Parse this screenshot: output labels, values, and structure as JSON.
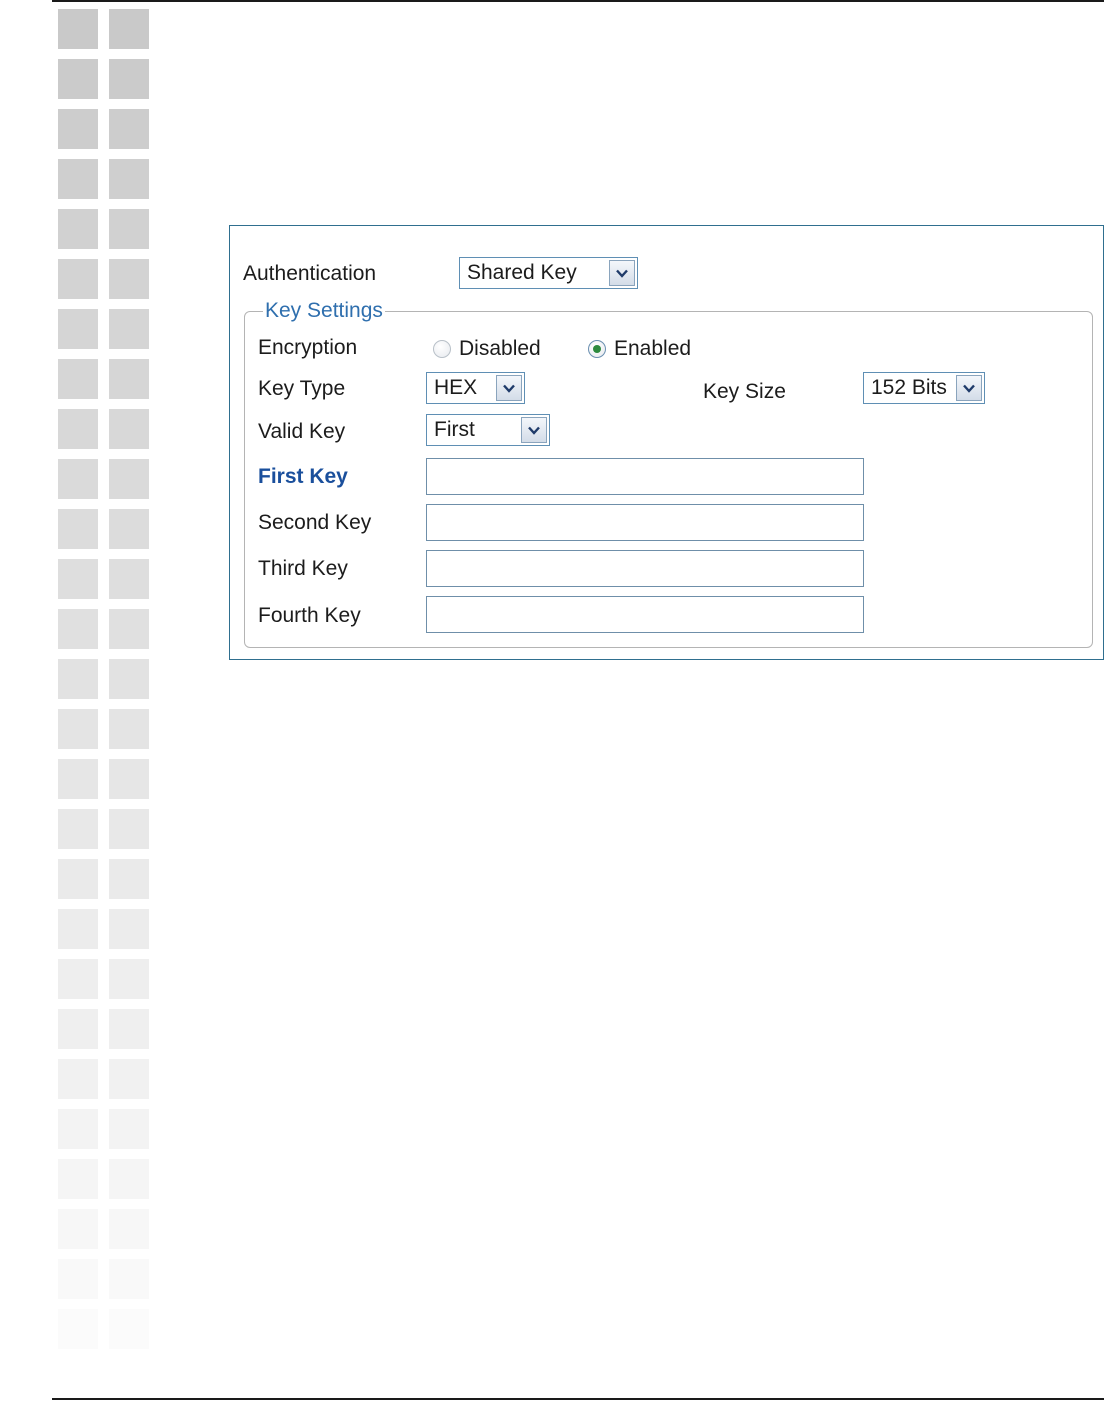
{
  "form": {
    "authentication": {
      "label": "Authentication",
      "value": "Shared Key"
    },
    "key_settings": {
      "legend": "Key Settings",
      "encryption": {
        "label": "Encryption",
        "options": [
          "Disabled",
          "Enabled"
        ],
        "selected": "Enabled"
      },
      "key_type": {
        "label": "Key Type",
        "value": "HEX"
      },
      "key_size": {
        "label": "Key Size",
        "value": "152 Bits"
      },
      "valid_key": {
        "label": "Valid Key",
        "value": "First"
      },
      "keys": [
        {
          "label": "First Key",
          "value": ""
        },
        {
          "label": "Second Key",
          "value": ""
        },
        {
          "label": "Third Key",
          "value": ""
        },
        {
          "label": "Fourth Key",
          "value": ""
        }
      ]
    }
  },
  "colors": {
    "panel_border": "#2f6f8f",
    "legend_text": "#2f6fae",
    "active_key_label": "#1a4f9c",
    "radio_selected": "#2d8a3e"
  }
}
